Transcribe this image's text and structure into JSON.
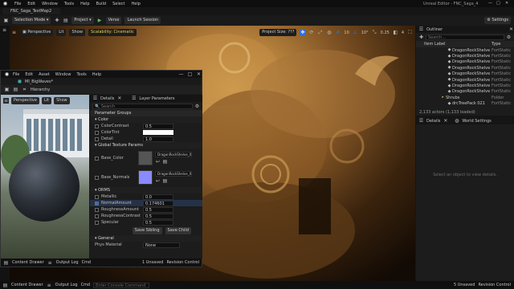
{
  "app": {
    "title_left": "FNC_Saga_TestMap2",
    "title_right": "Unreal Editor - FNC_Saga_4",
    "menu": [
      "File",
      "Edit",
      "Window",
      "Tools",
      "Help",
      "Build",
      "Select",
      "Help"
    ]
  },
  "toolbar": {
    "mode": "Selection Mode",
    "project": "Project",
    "verse": "Verse",
    "launch": "Launch Session",
    "settings": "Settings"
  },
  "viewport": {
    "perspective": "Perspective",
    "lit": "Lit",
    "show": "Show",
    "scalability": "Scalability: Cinematic",
    "project_size": "Project Size: ???",
    "grid_value": "10",
    "rot_value": "10°",
    "scale_value": "0.25",
    "cam_value": "4"
  },
  "outliner": {
    "tab": "Outliner",
    "search_placeholder": "Search...",
    "col_label": "Item Label",
    "col_type": "Type",
    "items": [
      {
        "label": "DragonRockShelve",
        "type": "FortStatic"
      },
      {
        "label": "DragonRockShelve",
        "type": "FortStatic"
      },
      {
        "label": "DragonRockShelve",
        "type": "FortStatic"
      },
      {
        "label": "DragonRockShelve",
        "type": "FortStatic"
      },
      {
        "label": "DragonRockShelve",
        "type": "FortStatic"
      },
      {
        "label": "DragonRockShelve",
        "type": "FortStatic"
      },
      {
        "label": "DragonRockShelve",
        "type": "FortStatic"
      },
      {
        "label": "DragonRockShelve",
        "type": "FortStatic"
      },
      {
        "label": "Shrubs",
        "type": "Folder"
      },
      {
        "label": "drcTreePack 021",
        "type": "FortStatic"
      }
    ],
    "status": "2,133 actors (1,133 loaded)"
  },
  "details_right": {
    "tab1": "Details",
    "tab2": "World Settings",
    "empty": "Select an object to view details."
  },
  "material_window": {
    "title": "MI_BigWaves*",
    "menu": [
      "File",
      "Edit",
      "Asset",
      "Window",
      "Tools",
      "Help"
    ],
    "hierarchy": "Hierarchy",
    "preview_buttons": [
      "Perspective",
      "Lit",
      "Show"
    ],
    "tab_details": "Details",
    "tab_params": "Layer Parameters",
    "search_placeholder": "Search",
    "param_group_header": "Parameter Groups",
    "groups": {
      "color": "Color",
      "global_tex": "Global Texture Params",
      "orms": "ORMS",
      "general": "General"
    },
    "color_params": [
      {
        "name": "ColorContrast",
        "value": "0.5"
      },
      {
        "name": "ColorTint",
        "value": ""
      },
      {
        "name": "Detail",
        "value": "1.0"
      }
    ],
    "tex_params": [
      {
        "name": "Base_Color",
        "value": "DragonRockShelve_01_D"
      },
      {
        "name": "Base_Normals",
        "value": "DragonRockShelve_01_N"
      }
    ],
    "orms_params": [
      {
        "name": "Metallic",
        "value": "0.0"
      },
      {
        "name": "NormalAmount",
        "value": "0.174601"
      },
      {
        "name": "RoughnessAmount",
        "value": "0.5"
      },
      {
        "name": "RoughnessContrast",
        "value": "0.5"
      },
      {
        "name": "Specular",
        "value": "0.5"
      }
    ],
    "save_sibling": "Save Sibling",
    "save_child": "Save Child",
    "general_label": "Phys Material",
    "general_value": "None",
    "content_drawer": "Content Drawer",
    "output_log": "Output Log",
    "cmd": "Cmd",
    "unsaved": "1 Unsaved",
    "revision": "Revision Control"
  },
  "statusbar": {
    "content_drawer": "Content Drawer",
    "output_log": "Output Log",
    "cmd": "Cmd",
    "cmd_placeholder": "Enter Console Command",
    "unsaved": "5 Unsaved",
    "revision": "Revision Control"
  },
  "colors": {
    "accent_blue": "#2f6fd6",
    "rock_light": "#d9a95a",
    "rock_dark": "#120a04",
    "tint_swatch": "#8a8aff"
  }
}
